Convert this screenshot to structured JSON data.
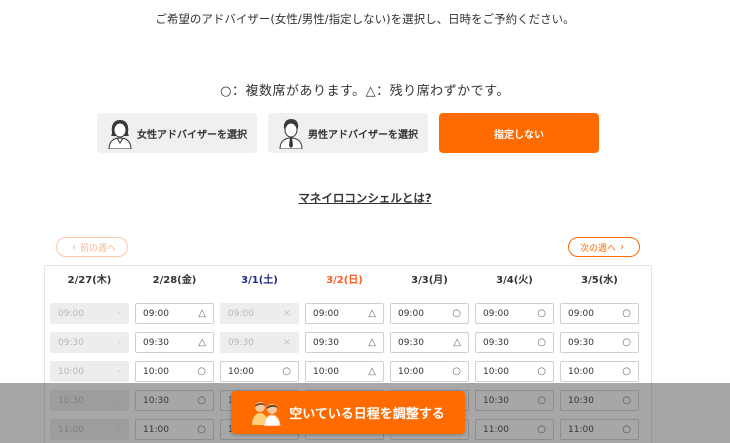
{
  "intro_text": "ご希望のアドバイザー(女性/男性/指定しない)を選択し、日時をご予約ください。",
  "legend_text": "○：複数席があります。△：残り席わずかです。",
  "adviser_buttons": {
    "female": "女性アドバイザーを選択",
    "male": "男性アドバイザーを選択",
    "any": "指定しない"
  },
  "concierge_link": "マネイロコンシェルとは?",
  "nav": {
    "prev_week": "前の週へ",
    "next_week": "次の週へ"
  },
  "colors": {
    "accent": "#ff6b00",
    "saturday": "#1e2a8c",
    "sunday": "#ff5a1f",
    "disabled_bg": "#ededed"
  },
  "calendar": {
    "days": [
      {
        "label": "2/27(木)",
        "type": "weekday"
      },
      {
        "label": "2/28(金)",
        "type": "weekday"
      },
      {
        "label": "3/1(土)",
        "type": "sat"
      },
      {
        "label": "3/2(日)",
        "type": "sun"
      },
      {
        "label": "3/3(月)",
        "type": "weekday"
      },
      {
        "label": "3/4(火)",
        "type": "weekday"
      },
      {
        "label": "3/5(水)",
        "type": "weekday"
      }
    ],
    "times": [
      "09:00",
      "09:30",
      "10:00",
      "10:30",
      "11:00"
    ],
    "slots": [
      [
        {
          "m": "-",
          "d": true
        },
        {
          "m": "△",
          "d": false
        },
        {
          "m": "×",
          "d": true
        },
        {
          "m": "△",
          "d": false
        },
        {
          "m": "○",
          "d": false
        },
        {
          "m": "○",
          "d": false
        },
        {
          "m": "○",
          "d": false
        }
      ],
      [
        {
          "m": "-",
          "d": true
        },
        {
          "m": "△",
          "d": false
        },
        {
          "m": "×",
          "d": true
        },
        {
          "m": "△",
          "d": false
        },
        {
          "m": "△",
          "d": false
        },
        {
          "m": "○",
          "d": false
        },
        {
          "m": "○",
          "d": false
        }
      ],
      [
        {
          "m": "-",
          "d": true
        },
        {
          "m": "○",
          "d": false
        },
        {
          "m": "○",
          "d": false
        },
        {
          "m": "△",
          "d": false
        },
        {
          "m": "○",
          "d": false
        },
        {
          "m": "○",
          "d": false
        },
        {
          "m": "○",
          "d": false
        }
      ],
      [
        {
          "m": "-",
          "d": true
        },
        {
          "m": "○",
          "d": false
        },
        {
          "m": "○",
          "d": false
        },
        {
          "m": "○",
          "d": false
        },
        {
          "m": "○",
          "d": false
        },
        {
          "m": "○",
          "d": false
        },
        {
          "m": "○",
          "d": false
        }
      ],
      [
        {
          "m": "-",
          "d": true
        },
        {
          "m": "○",
          "d": false
        },
        {
          "m": "○",
          "d": false
        },
        {
          "m": "○",
          "d": false
        },
        {
          "m": "○",
          "d": false
        },
        {
          "m": "○",
          "d": false
        },
        {
          "m": "○",
          "d": false
        }
      ]
    ]
  },
  "adjust_button": "空いている日程を調整する"
}
